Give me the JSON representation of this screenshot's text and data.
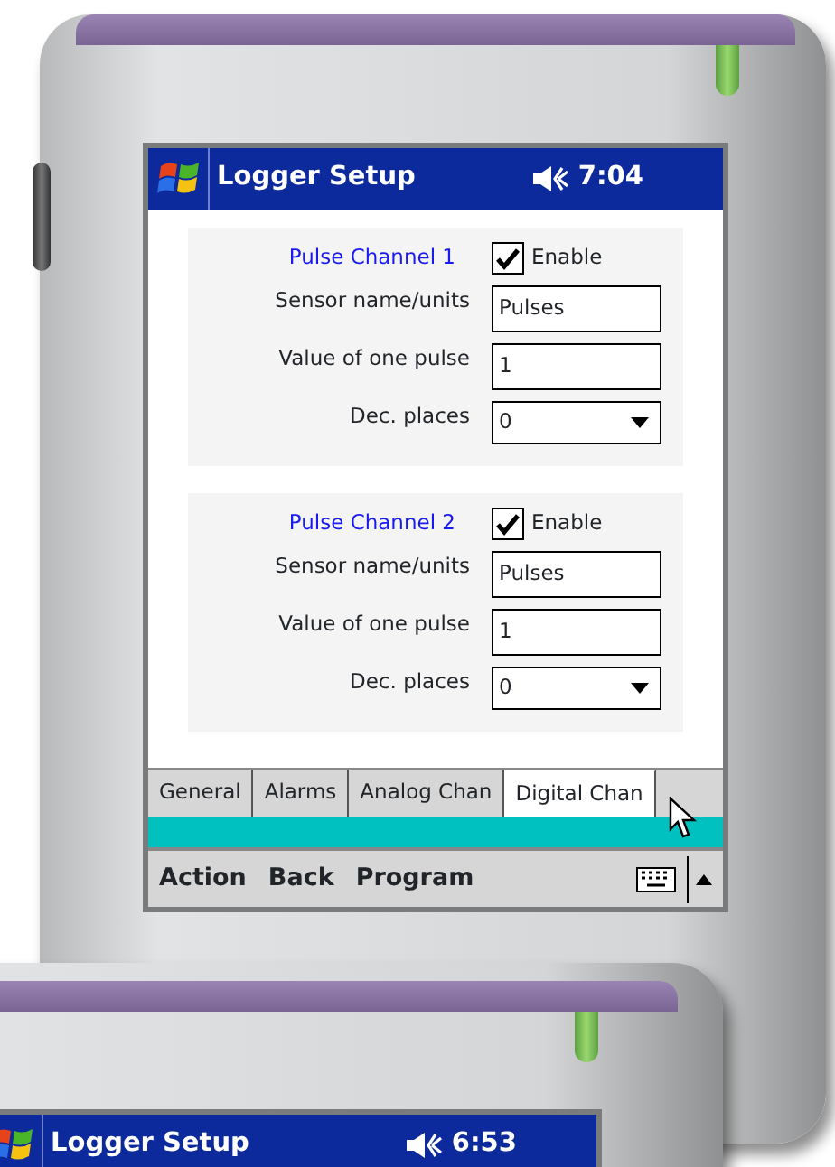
{
  "devices": [
    {
      "title": "Logger Setup",
      "time": "7:04",
      "channels": [
        {
          "heading": "Pulse Channel 1",
          "enable_label": "Enable",
          "checked": true,
          "fields": [
            {
              "label": "Sensor name/units",
              "value": "Pulses",
              "kind": "text"
            },
            {
              "label": "Value of one pulse",
              "value": "1",
              "kind": "text"
            },
            {
              "label": "Dec. places",
              "value": "0",
              "kind": "select"
            }
          ]
        },
        {
          "heading": "Pulse Channel 2",
          "enable_label": "Enable",
          "checked": true,
          "fields": [
            {
              "label": "Sensor name/units",
              "value": "Pulses",
              "kind": "text"
            },
            {
              "label": "Value of one pulse",
              "value": "1",
              "kind": "text"
            },
            {
              "label": "Dec. places",
              "value": "0",
              "kind": "select"
            }
          ]
        }
      ],
      "tabs": [
        {
          "label": "General",
          "selected": false
        },
        {
          "label": "Alarms",
          "selected": false
        },
        {
          "label": "Analog Chan",
          "selected": false
        },
        {
          "label": "Digital Chan",
          "selected": true
        }
      ],
      "menu": [
        "Action",
        "Back",
        "Program"
      ]
    },
    {
      "title": "Logger Setup",
      "time": "6:53"
    }
  ]
}
